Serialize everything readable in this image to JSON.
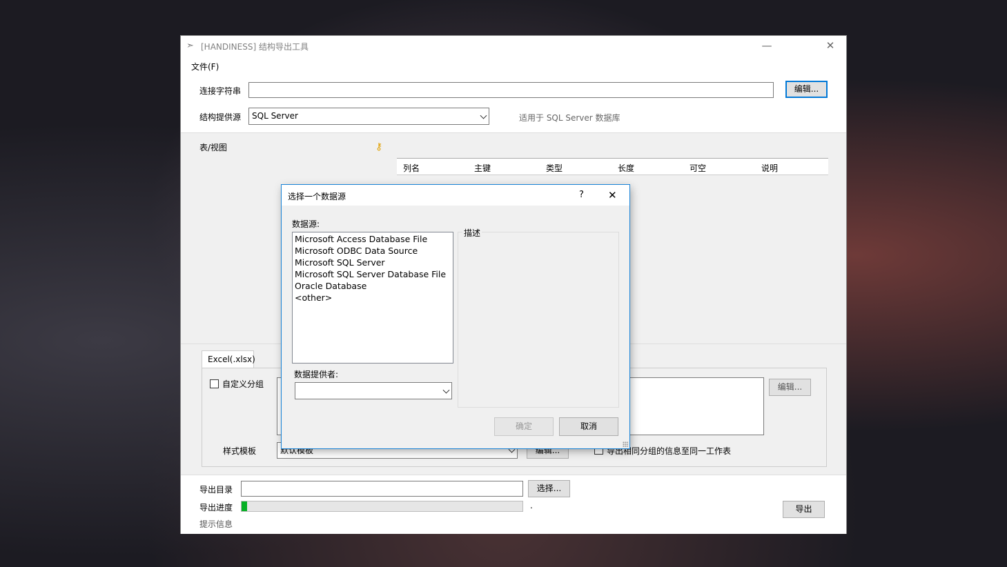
{
  "window": {
    "title": "[HANDINESS] 结构导出工具",
    "minimize": "—",
    "close": "✕"
  },
  "menu": {
    "file": "文件(F)"
  },
  "connection": {
    "label": "连接字符串",
    "value": "",
    "edit_button": "编辑..."
  },
  "provider": {
    "label": "结构提供源",
    "selected": "SQL Server",
    "hint": "适用于 SQL Server 数据库"
  },
  "tables": {
    "label": "表/视图",
    "columns": [
      "列名",
      "主键",
      "类型",
      "长度",
      "可空",
      "说明"
    ]
  },
  "export_options": {
    "tab": "Excel(.xlsx)",
    "custom_group": "自定义分组",
    "edit_button": "编辑...",
    "style_label": "样式模板",
    "style_selected": "默认模板",
    "style_edit_button": "编辑...",
    "same_sheet": "导出相同分组的信息至同一工作表"
  },
  "output": {
    "dir_label": "导出目录",
    "dir_value": "",
    "choose_button": "选择...",
    "progress_label": "导出进度",
    "progress": 0.02,
    "progress_text": ".",
    "export_button": "导出",
    "info_label": "提示信息"
  },
  "dialog": {
    "title": "选择一个数据源",
    "help": "?",
    "close": "✕",
    "source_label": "数据源:",
    "sources": [
      "Microsoft Access Database File",
      "Microsoft ODBC Data Source",
      "Microsoft SQL Server",
      "Microsoft SQL Server Database File",
      "Oracle Database",
      "<other>"
    ],
    "provider_label": "数据提供者:",
    "provider_value": "",
    "desc_label": "描述",
    "ok": "确定",
    "cancel": "取消"
  }
}
